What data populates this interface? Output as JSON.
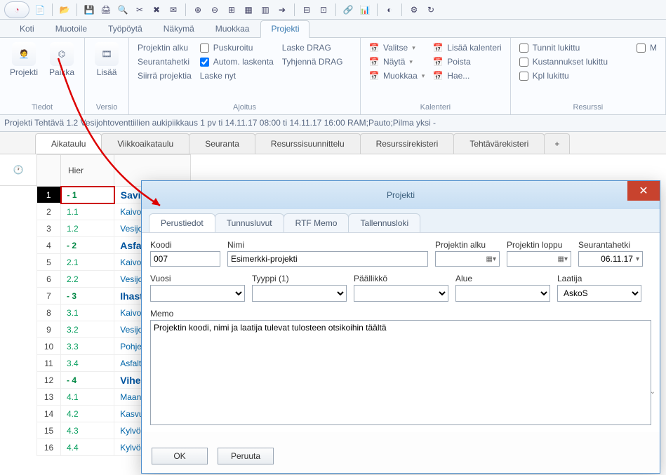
{
  "menu": {
    "tabs": [
      "Koti",
      "Muotoile",
      "Työpöytä",
      "Näkymä",
      "Muokkaa",
      "Projekti"
    ],
    "active": 5
  },
  "ribbon": {
    "tiedot": {
      "label": "Tiedot",
      "btn1": "Projekti",
      "btn2": "Paikka"
    },
    "versio": {
      "label": "Versio",
      "btn": "Lisää"
    },
    "ajoitus": {
      "label": "Ajoitus",
      "c1": [
        "Projektin alku",
        "Seurantahetki",
        "Siirrä projektia"
      ],
      "c2": [
        {
          "l": "Puskuroitu",
          "c": false
        },
        {
          "l": "Autom. laskenta",
          "c": true
        }
      ],
      "c2b": "Laske nyt",
      "c3": [
        "Laske DRAG",
        "Tyhjennä DRAG"
      ]
    },
    "kalenteri": {
      "label": "Kalenteri",
      "c1": [
        "Valitse",
        "Näytä",
        "Muokkaa"
      ],
      "c2": [
        "Lisää kalenteri",
        "Poista",
        "Hae..."
      ]
    },
    "resurssi": {
      "label": "Resurssi",
      "items": [
        {
          "l": "Tunnit lukittu",
          "c": false
        },
        {
          "l": "Kustannukset lukittu",
          "c": false
        },
        {
          "l": "Kpl lukittu",
          "c": false
        }
      ],
      "right": "M"
    }
  },
  "status": "Projekti   Tehtävä 1.2    Vesijohtoventtiilien aukipiikkaus  1 pv  ti 14.11.17 08:00  ti 14.11.17 16:00    RAM;Pauto;Pilma yksi -",
  "sectabs": [
    "Aikataulu",
    "Viikkoaikataulu",
    "Seuranta",
    "Resurssisuunnittelu",
    "Resurssirekisteri",
    "Tehtävärekisteri"
  ],
  "grid": {
    "header": "Hier",
    "rows": [
      {
        "n": 1,
        "h": "- 1",
        "name": "Savisi",
        "hdr": true,
        "box": true
      },
      {
        "n": 2,
        "h": "1.1",
        "name": "Kaivoj"
      },
      {
        "n": 3,
        "h": "1.2",
        "name": "Vesijo"
      },
      {
        "n": 4,
        "h": "- 2",
        "name": "Asfalt",
        "hdr": true
      },
      {
        "n": 5,
        "h": "2.1",
        "name": "Kaivoj"
      },
      {
        "n": 6,
        "h": "2.2",
        "name": "Vesijo"
      },
      {
        "n": 7,
        "h": "- 3",
        "name": "Ihastjä",
        "hdr": true
      },
      {
        "n": 8,
        "h": "3.1",
        "name": "Kaivoj"
      },
      {
        "n": 9,
        "h": "3.2",
        "name": "Vesijo"
      },
      {
        "n": 10,
        "h": "3.3",
        "name": "Pohje"
      },
      {
        "n": 11,
        "h": "3.4",
        "name": "Asfaltt"
      },
      {
        "n": 12,
        "h": "- 4",
        "name": "Vihert",
        "hdr": true
      },
      {
        "n": 13,
        "h": "4.1",
        "name": "Maanl"
      },
      {
        "n": 14,
        "h": "4.2",
        "name": "Kasvu"
      },
      {
        "n": 15,
        "h": "4.3",
        "name": "Kylvö"
      },
      {
        "n": 16,
        "h": "4.4",
        "name": "Kylvö"
      }
    ]
  },
  "dialog": {
    "title": "Projekti",
    "tabs": [
      "Perustiedot",
      "Tunnusluvut",
      "RTF Memo",
      "Tallennusloki"
    ],
    "labels": {
      "koodi": "Koodi",
      "nimi": "Nimi",
      "alku": "Projektin alku",
      "loppu": "Projektin loppu",
      "seur": "Seurantahetki",
      "vuosi": "Vuosi",
      "tyyppi": "Tyyppi (1)",
      "paallikko": "Päällikkö",
      "alue": "Alue",
      "laatija": "Laatija",
      "memo": "Memo"
    },
    "values": {
      "koodi": "007",
      "nimi": "Esimerkki-projekti",
      "alku": "",
      "loppu": "",
      "seur": "06.11.17",
      "vuosi": "",
      "tyyppi": "",
      "paallikko": "",
      "alue": "",
      "laatija": "AskoS",
      "memo": "Projektin koodi, nimi ja laatija tulevat tulosteen otsikoihin täältä"
    },
    "buttons": {
      "ok": "OK",
      "cancel": "Peruuta"
    }
  }
}
